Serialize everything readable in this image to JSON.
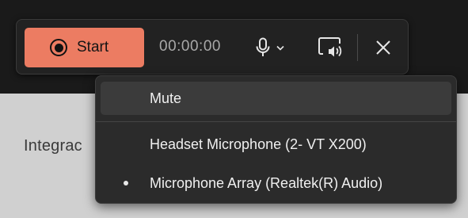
{
  "background": {
    "partial_text": "Integrac"
  },
  "toolbar": {
    "start_label": "Start",
    "timer": "00:00:00",
    "accent_color": "#ec7c62"
  },
  "mic_menu": {
    "items": [
      {
        "label": "Mute",
        "hovered": true
      },
      {
        "label": "Headset Microphone (2- VT X200)",
        "selected": false
      },
      {
        "label": "Microphone Array (Realtek(R) Audio)",
        "selected": true
      }
    ]
  },
  "icons": {
    "record": "record-icon",
    "microphone": "microphone-icon",
    "dropdown": "chevron-down-icon",
    "system_audio": "screen-audio-icon",
    "close": "close-icon"
  }
}
